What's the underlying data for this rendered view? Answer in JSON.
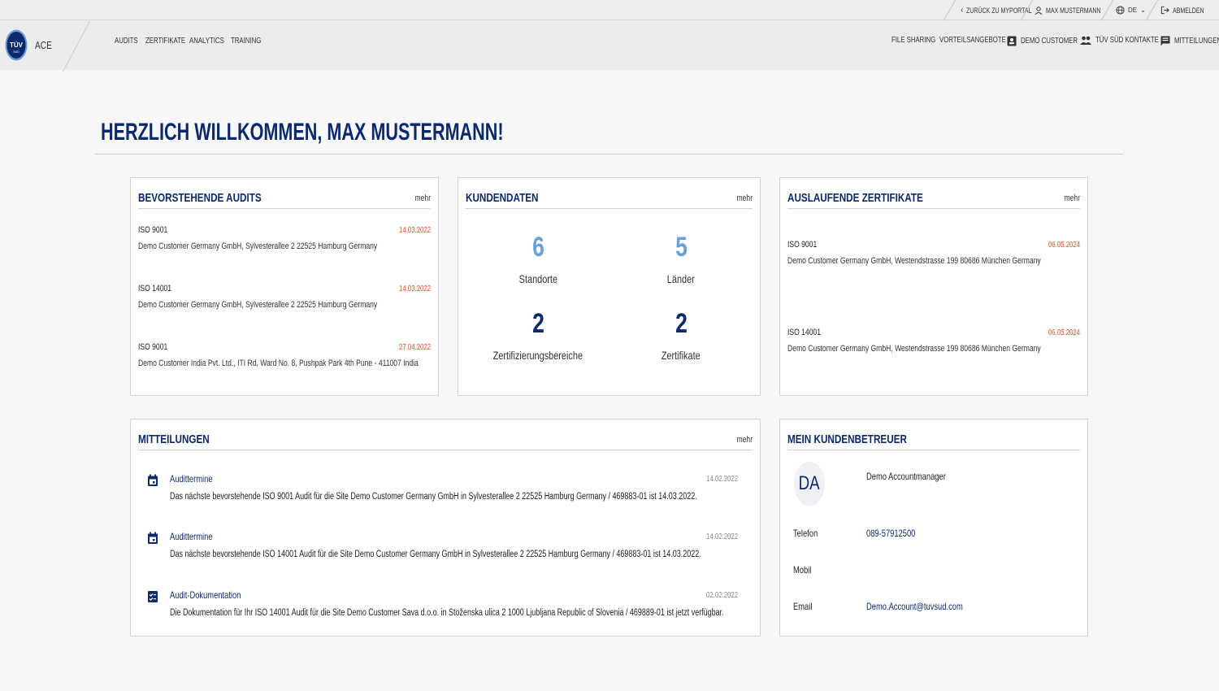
{
  "topbar": {
    "back_label": "ZURÜCK ZU MYPORTAL",
    "user_label": "MAX MUSTERMANN",
    "language": "DE",
    "logout_label": "ABMELDEN"
  },
  "navbar": {
    "app_name": "ACE",
    "left_items": [
      {
        "label": "AUDITS"
      },
      {
        "label": "ZERTIFIKATE"
      },
      {
        "label": "ANALYTICS"
      },
      {
        "label": "TRAINING"
      }
    ],
    "right_items": [
      {
        "label": "FILE SHARING",
        "icon": ""
      },
      {
        "label": "VORTEILSANGEBOTE",
        "icon": ""
      },
      {
        "label": "DEMO CUSTOMER",
        "icon": "contact-card-icon"
      },
      {
        "label": "TÜV SÜD KONTAKTE",
        "icon": "people-icon"
      },
      {
        "label": "MITTEILUNGEN",
        "icon": "message-icon"
      }
    ]
  },
  "page": {
    "title": "HERZLICH WILLKOMMEN, MAX MUSTERMANN!"
  },
  "audits": {
    "title": "BEVORSTEHENDE AUDITS",
    "more": "mehr",
    "items": [
      {
        "standard": "ISO 9001",
        "date": "14.03.2022",
        "address": "Demo Customer Germany GmbH, Sylvesterallee 2 22525 Hamburg Germany"
      },
      {
        "standard": "ISO 14001",
        "date": "14.03.2022",
        "address": "Demo Customer Germany GmbH, Sylvesterallee 2 22525 Hamburg Germany"
      },
      {
        "standard": "ISO 9001",
        "date": "27.04.2022",
        "address": "Demo Customer India Pvt. Ltd., ITI Rd, Ward No. 8, Pushpak Park 4th Pune - 411007 India"
      }
    ]
  },
  "customer": {
    "title": "KUNDENDATEN",
    "more": "mehr",
    "stats": [
      {
        "value": "6",
        "label": "Standorte"
      },
      {
        "value": "5",
        "label": "Länder"
      },
      {
        "value": "2",
        "label": "Zertifizierungsbereiche"
      },
      {
        "value": "2",
        "label": "Zertifikate"
      }
    ]
  },
  "expiring": {
    "title": "AUSLAUFENDE ZERTIFIKATE",
    "more": "mehr",
    "items": [
      {
        "standard": "ISO 9001",
        "date": "06.05.2024",
        "address": "Demo Customer Germany GmbH, Westendstrasse 199 80686 München Germany"
      },
      {
        "standard": "ISO 14001",
        "date": "06.05.2024",
        "address": "Demo Customer Germany GmbH, Westendstrasse 199 80686 München Germany"
      }
    ]
  },
  "messages": {
    "title": "MITTEILUNGEN",
    "more": "mehr",
    "items": [
      {
        "icon": "calendar-icon",
        "title": "Audittermine",
        "date": "14.02.2022",
        "text": "Das nächste bevorstehende ISO 9001 Audit für die Site Demo Customer Germany GmbH in Sylvesterallee 2 22525 Hamburg Germany / 469883-01 ist 14.03.2022."
      },
      {
        "icon": "calendar-icon",
        "title": "Audittermine",
        "date": "14.02.2022",
        "text": "Das nächste bevorstehende ISO 14001 Audit für die Site Demo Customer Germany GmbH in Sylvesterallee 2 22525 Hamburg Germany / 469883-01 ist 14.03.2022."
      },
      {
        "icon": "checklist-icon",
        "title": "Audit-Dokumentation",
        "date": "02.02.2022",
        "text": "Die Dokumentation für Ihr ISO 14001 Audit für die Site Demo Customer Sava d.o.o. in Stoženska ulica 2 1000 Ljubljana Republic of Slovenia / 469889-01 ist jetzt verfügbar."
      }
    ]
  },
  "account_manager": {
    "title": "MEIN KUNDENBETREUER",
    "initials": "DA",
    "name": "Demo Accountmanager",
    "phone_label": "Telefon",
    "phone": "089-57912500",
    "mobile_label": "Mobil",
    "mobile": "",
    "email_label": "Email",
    "email": "Demo.Account@tuvsud.com"
  },
  "colors": {
    "brand_navy": "#0b2a6b",
    "date_orange": "#e0501e",
    "stat_light": "#6aa0d8"
  }
}
